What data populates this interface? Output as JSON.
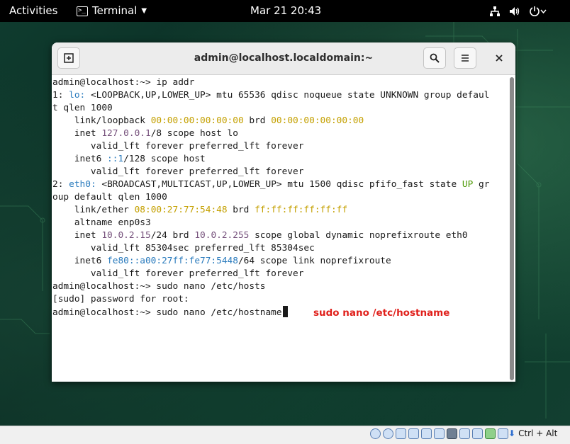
{
  "topbar": {
    "activities": "Activities",
    "app_name": "Terminal",
    "clock": "Mar 21  20:43"
  },
  "window": {
    "title": "admin@localhost.localdomain:~"
  },
  "terminal": {
    "lines": [
      [
        {
          "t": "admin@localhost:~> ip addr"
        }
      ],
      [
        {
          "t": "1: "
        },
        {
          "t": "lo:",
          "c": "blue"
        },
        {
          "t": " <LOOPBACK,UP,LOWER_UP> mtu 65536 qdisc noqueue state UNKNOWN group defaul"
        }
      ],
      [
        {
          "t": "t qlen 1000"
        }
      ],
      [
        {
          "t": "    link/loopback "
        },
        {
          "t": "00:00:00:00:00:00",
          "c": "yellow"
        },
        {
          "t": " brd "
        },
        {
          "t": "00:00:00:00:00:00",
          "c": "yellow"
        }
      ],
      [
        {
          "t": "    inet "
        },
        {
          "t": "127.0.0.1",
          "c": "purple"
        },
        {
          "t": "/8 scope host lo"
        }
      ],
      [
        {
          "t": "       valid_lft forever preferred_lft forever"
        }
      ],
      [
        {
          "t": "    inet6 "
        },
        {
          "t": "::1",
          "c": "blue"
        },
        {
          "t": "/128 scope host"
        }
      ],
      [
        {
          "t": "       valid_lft forever preferred_lft forever"
        }
      ],
      [
        {
          "t": "2: "
        },
        {
          "t": "eth0:",
          "c": "blue"
        },
        {
          "t": " <BROADCAST,MULTICAST,UP,LOWER_UP> mtu 1500 qdisc pfifo_fast state "
        },
        {
          "t": "UP",
          "c": "green"
        },
        {
          "t": " gr"
        }
      ],
      [
        {
          "t": "oup default qlen 1000"
        }
      ],
      [
        {
          "t": "    link/ether "
        },
        {
          "t": "08:00:27:77:54:48",
          "c": "yellow"
        },
        {
          "t": " brd "
        },
        {
          "t": "ff:ff:ff:ff:ff:ff",
          "c": "yellow"
        }
      ],
      [
        {
          "t": "    altname enp0s3"
        }
      ],
      [
        {
          "t": "    inet "
        },
        {
          "t": "10.0.2.15",
          "c": "purple"
        },
        {
          "t": "/24 brd "
        },
        {
          "t": "10.0.2.255",
          "c": "purple"
        },
        {
          "t": " scope global dynamic noprefixroute eth0"
        }
      ],
      [
        {
          "t": "       valid_lft 85304sec preferred_lft 85304sec"
        }
      ],
      [
        {
          "t": "    inet6 "
        },
        {
          "t": "fe80::a00:27ff:fe77:5448",
          "c": "blue"
        },
        {
          "t": "/64 scope link noprefixroute"
        }
      ],
      [
        {
          "t": "       valid_lft forever preferred_lft forever"
        }
      ],
      [
        {
          "t": "admin@localhost:~> sudo nano /etc/hosts"
        }
      ],
      [
        {
          "t": "[sudo] password for root:"
        }
      ],
      [
        {
          "t": "admin@localhost:~> sudo nano /etc/hostname"
        }
      ]
    ],
    "cursor_line": 18,
    "annotation": "sudo nano /etc/hostname"
  },
  "colors": {
    "blue": "#2a7bbd",
    "yellow": "#c4a000",
    "purple": "#75507b",
    "green": "#4e9a06",
    "annotation": "#e0201b"
  },
  "vbox_statusbar": {
    "host_key": "Ctrl + Alt"
  }
}
